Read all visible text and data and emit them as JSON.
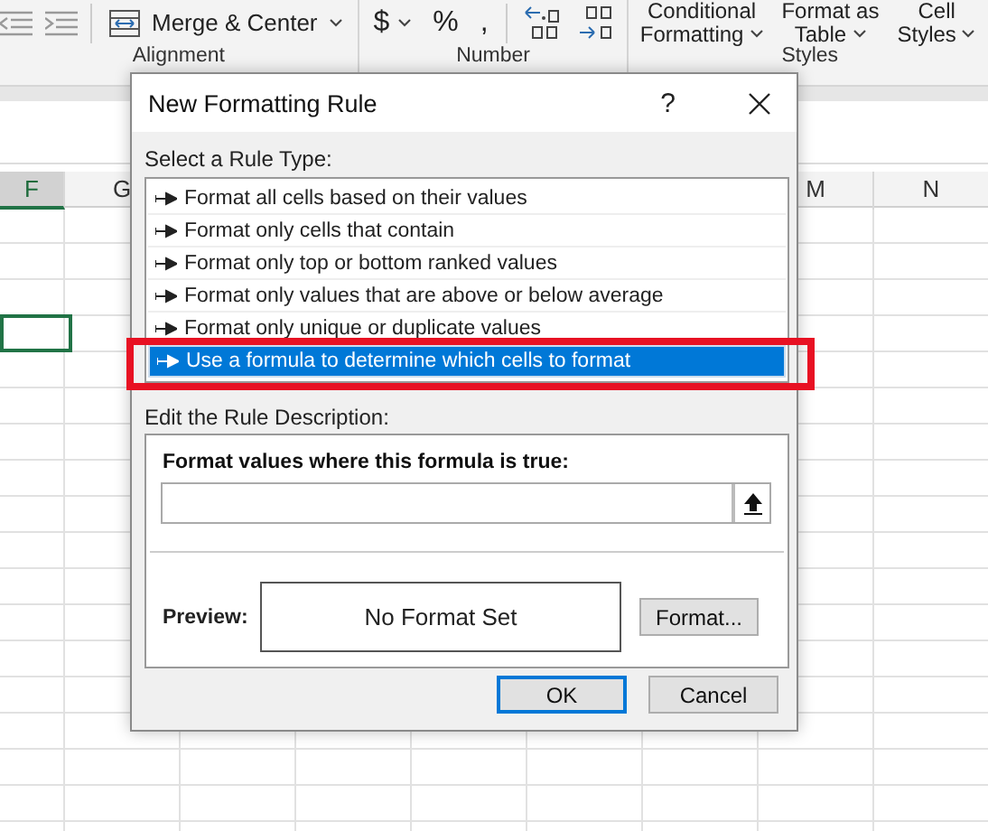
{
  "ribbon": {
    "groups": [
      {
        "label": "Alignment",
        "buttons": [
          {
            "kind": "merge",
            "label": "Merge & Center"
          }
        ]
      },
      {
        "label": "Number",
        "buttons": [
          {
            "kind": "text",
            "label": "$",
            "caret": true
          },
          {
            "kind": "text",
            "label": "%",
            "caret": false
          },
          {
            "kind": "text",
            "label": ",",
            "caret": false
          }
        ]
      },
      {
        "label": "Styles",
        "buttons": [
          {
            "kind": "stack",
            "lines": [
              "Conditional",
              "Formatting"
            ]
          },
          {
            "kind": "stack",
            "lines": [
              "Format as",
              "Table"
            ]
          },
          {
            "kind": "stack",
            "lines": [
              "Cell",
              "Styles"
            ]
          }
        ]
      }
    ]
  },
  "sheet": {
    "columns": [
      {
        "label": "F",
        "selected": true
      },
      {
        "label": "G",
        "selected": false
      },
      {
        "label": "M",
        "selected": false
      },
      {
        "label": "N",
        "selected": false
      }
    ]
  },
  "dialog": {
    "title": "New Formatting Rule",
    "help": "?",
    "rule_type_label": "Select a Rule Type:",
    "rule_types": [
      {
        "label": "Format all cells based on their values",
        "selected": false,
        "highlighted": false
      },
      {
        "label": "Format only cells that contain",
        "selected": false,
        "highlighted": false
      },
      {
        "label": "Format only top or bottom ranked values",
        "selected": false,
        "highlighted": false
      },
      {
        "label": "Format only values that are above or below average",
        "selected": false,
        "highlighted": false
      },
      {
        "label": "Format only unique or duplicate values",
        "selected": false,
        "highlighted": false
      },
      {
        "label": "Use a formula to determine which cells to format",
        "selected": true,
        "highlighted": true
      }
    ],
    "description_label": "Edit the Rule Description:",
    "formula_label": "Format values where this formula is true:",
    "preview_label": "Preview:",
    "preview_text": "No Format Set",
    "format_button": "Format...",
    "buttons": [
      {
        "label": "OK",
        "default": true
      },
      {
        "label": "Cancel",
        "default": false
      }
    ]
  }
}
